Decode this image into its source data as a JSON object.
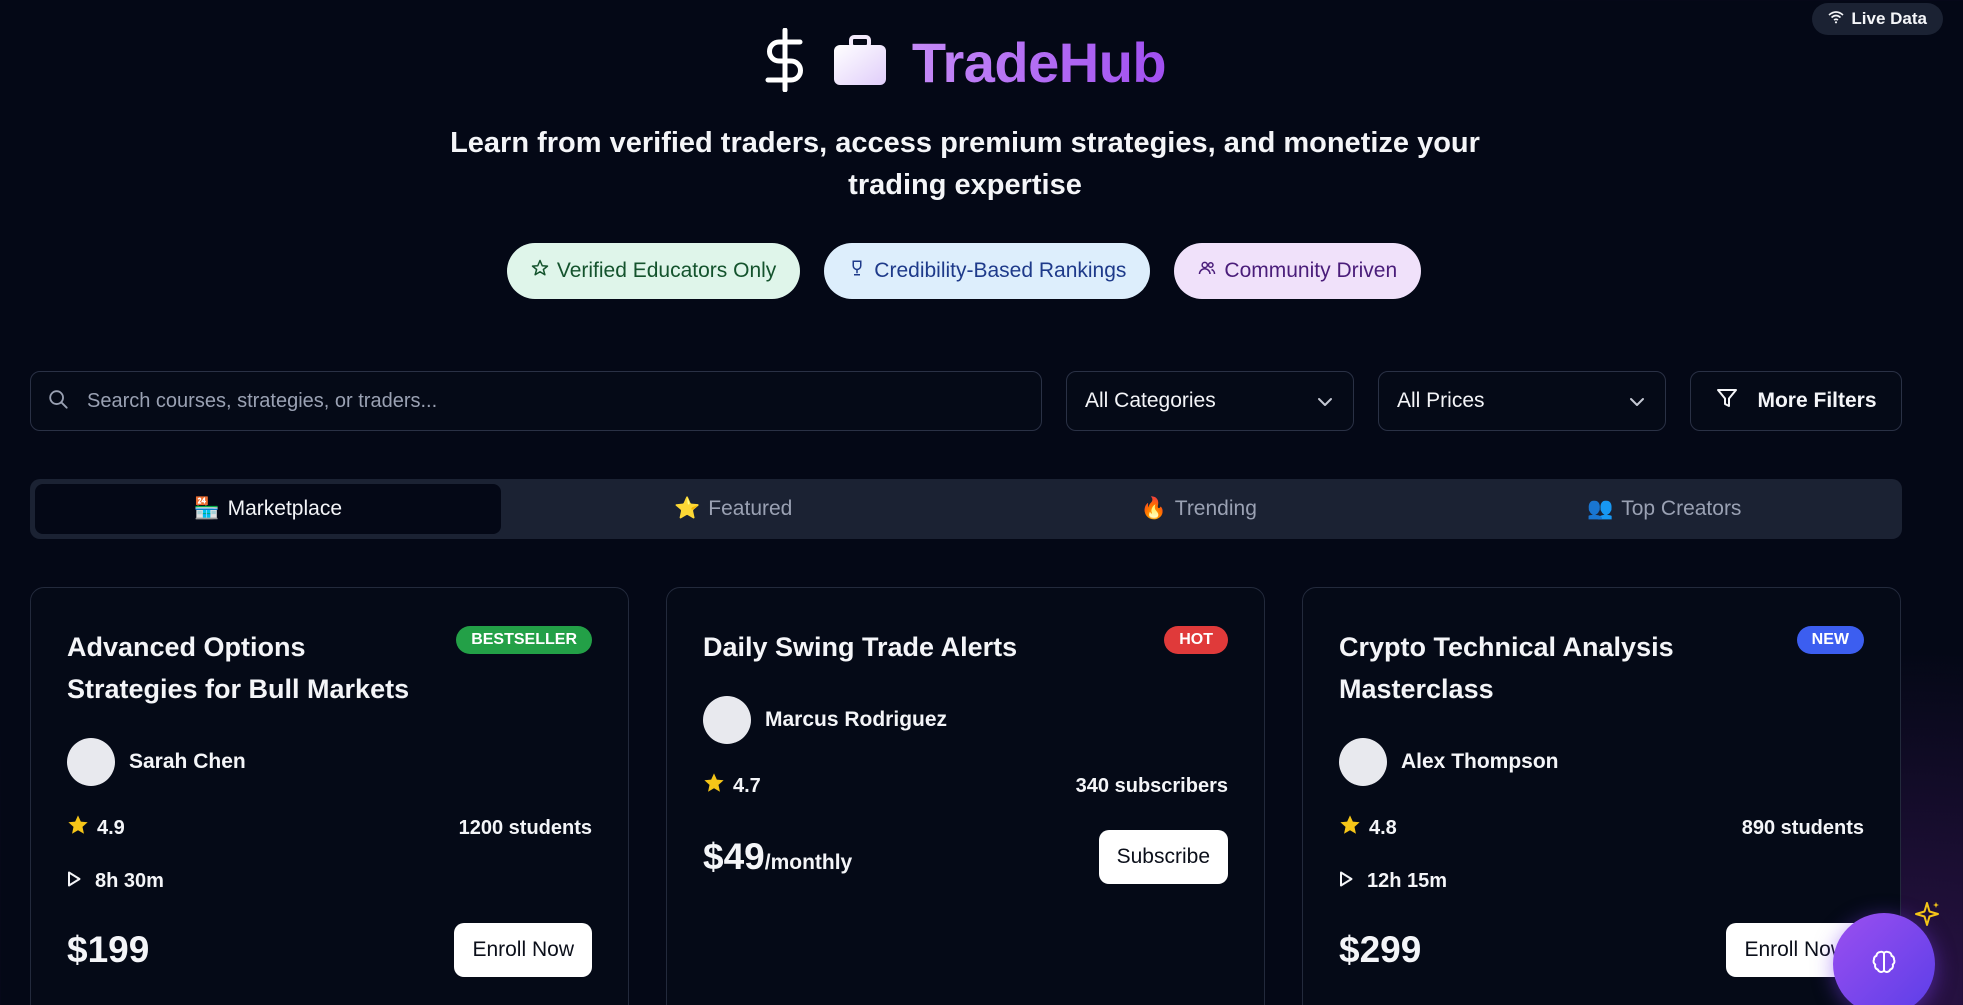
{
  "header": {
    "live_label": "Live Data",
    "brand": "TradeHub",
    "subtitle": "Learn from verified traders, access premium strategies, and monetize your trading expertise"
  },
  "pills": [
    {
      "label": "Verified Educators Only",
      "icon": "star-icon"
    },
    {
      "label": "Credibility-Based Rankings",
      "icon": "trophy-icon"
    },
    {
      "label": "Community Driven",
      "icon": "users-icon"
    }
  ],
  "filters": {
    "search_placeholder": "Search courses, strategies, or traders...",
    "category": "All Categories",
    "price": "All Prices",
    "more": "More Filters"
  },
  "tabs": [
    {
      "label": "Marketplace",
      "emoji": "🏪",
      "active": true
    },
    {
      "label": "Featured",
      "emoji": "⭐",
      "active": false
    },
    {
      "label": "Trending",
      "emoji": "🔥",
      "active": false
    },
    {
      "label": "Top Creators",
      "emoji": "👥",
      "active": false
    }
  ],
  "cards": [
    {
      "title": "Advanced Options Strategies for Bull Markets",
      "badge": "BESTSELLER",
      "author": "Sarah Chen",
      "rating": "4.9",
      "audience": "1200 students",
      "duration": "8h 30m",
      "price": "$199",
      "price_suffix": "",
      "button": "Enroll Now"
    },
    {
      "title": "Daily Swing Trade Alerts",
      "badge": "HOT",
      "author": "Marcus Rodriguez",
      "rating": "4.7",
      "audience": "340 subscribers",
      "duration": "",
      "price": "$49",
      "price_suffix": "/monthly",
      "button": "Subscribe"
    },
    {
      "title": "Crypto Technical Analysis Masterclass",
      "badge": "NEW",
      "author": "Alex Thompson",
      "rating": "4.8",
      "audience": "890 students",
      "duration": "12h 15m",
      "price": "$299",
      "price_suffix": "",
      "button": "Enroll Now"
    }
  ],
  "colors": {
    "background": "#040816",
    "brand_gradient_start": "#c58af7",
    "brand_gradient_end": "#a04ff0",
    "bestseller": "#23a047",
    "hot": "#e03a3a",
    "new": "#3c5ef0",
    "star": "#f5c518"
  }
}
